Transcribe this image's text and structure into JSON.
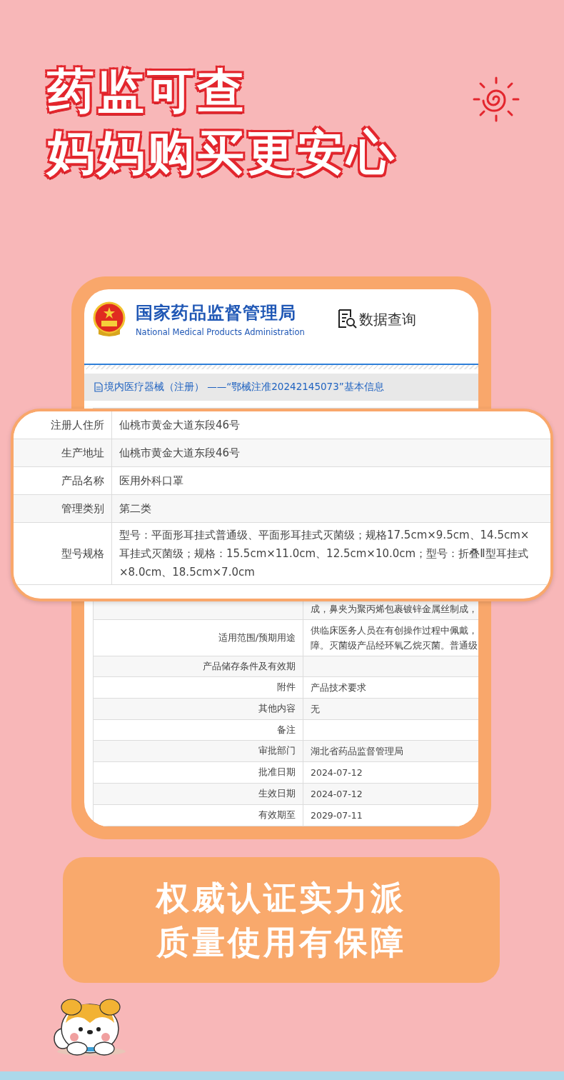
{
  "headline": {
    "lines": [
      "药监可查",
      "妈妈购买更安心"
    ]
  },
  "site": {
    "name_cn": "国家药品监督管理局",
    "name_en": "National Medical Products Administration",
    "query_label": "数据查询"
  },
  "record_title": "境内医疗器械（注册） ——“鄂械注准20242145073”基本信息",
  "table_rows": [
    {
      "value_lines": [
        "成，鼻夹为聚丙烯包裹镀锌金属丝制成，"
      ]
    },
    {
      "label": "适用范围/预期用途",
      "value_lines": [
        "供临床医务人员在有创操作过程中佩戴，",
        "障。灭菌级产品经环氧乙烷灭菌。普通级"
      ]
    },
    {
      "label": "产品储存条件及有效期"
    },
    {
      "label": "附件",
      "value_lines": [
        "产品技术要求"
      ]
    },
    {
      "label": "其他内容",
      "value_lines": [
        "无"
      ]
    },
    {
      "label": "备注"
    },
    {
      "label": "审批部门",
      "value_lines": [
        "湖北省药品监督管理局"
      ]
    },
    {
      "label": "批准日期",
      "value_lines": [
        "2024-07-12"
      ]
    },
    {
      "label": "生效日期",
      "value_lines": [
        "2024-07-12"
      ]
    },
    {
      "label": "有效期至",
      "value_lines": [
        "2029-07-11"
      ]
    }
  ],
  "zoom_rows": [
    {
      "label": "注册人住所",
      "value_lines": [
        "仙桃市黄金大道东段46号"
      ]
    },
    {
      "label": "生产地址",
      "value_lines": [
        "仙桃市黄金大道东段46号"
      ]
    },
    {
      "label": "产品名称",
      "value_lines": [
        "医用外科口罩"
      ]
    },
    {
      "label": "管理类别",
      "value_lines": [
        "第二类"
      ]
    },
    {
      "label": "型号规格",
      "value_lines": [
        "型号：平面形耳挂式普通级、平面形耳挂式灭菌级；规格17.5cm×9.5cm、14.5cm×",
        "耳挂式灭菌级；规格：15.5cm×11.0cm、12.5cm×10.0cm；型号：折叠Ⅱ型耳挂式",
        "×8.0cm、18.5cm×7.0cm"
      ]
    }
  ],
  "banner": {
    "lines": [
      "权威认证实力派",
      "质量使用有保障"
    ]
  }
}
